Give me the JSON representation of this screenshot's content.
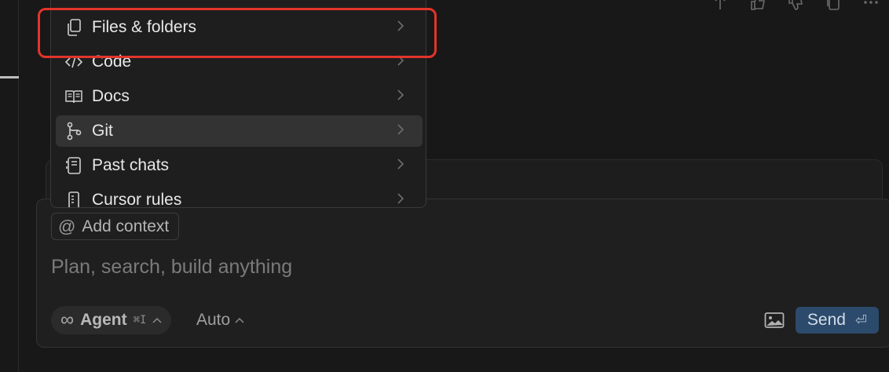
{
  "menu": {
    "items": [
      {
        "label": "Files & folders",
        "icon": "files-icon"
      },
      {
        "label": "Code",
        "icon": "code-icon"
      },
      {
        "label": "Docs",
        "icon": "book-icon"
      },
      {
        "label": "Git",
        "icon": "git-branch-icon",
        "active": true
      },
      {
        "label": "Past chats",
        "icon": "chat-history-icon"
      },
      {
        "label": "Cursor rules",
        "icon": "rules-file-icon"
      }
    ]
  },
  "composer": {
    "add_context_label": "Add context",
    "add_context_symbol": "@",
    "prompt_placeholder": "Plan, search, build anything",
    "agent_symbol": "∞",
    "agent_label": "Agent",
    "agent_shortcut": "⌘I",
    "model_label": "Auto",
    "send_label": "Send",
    "send_key_symbol": "⏎"
  },
  "colors": {
    "highlight": "#e3342a",
    "send_bg": "#2c4a6b",
    "menu_active_bg": "#333333"
  }
}
